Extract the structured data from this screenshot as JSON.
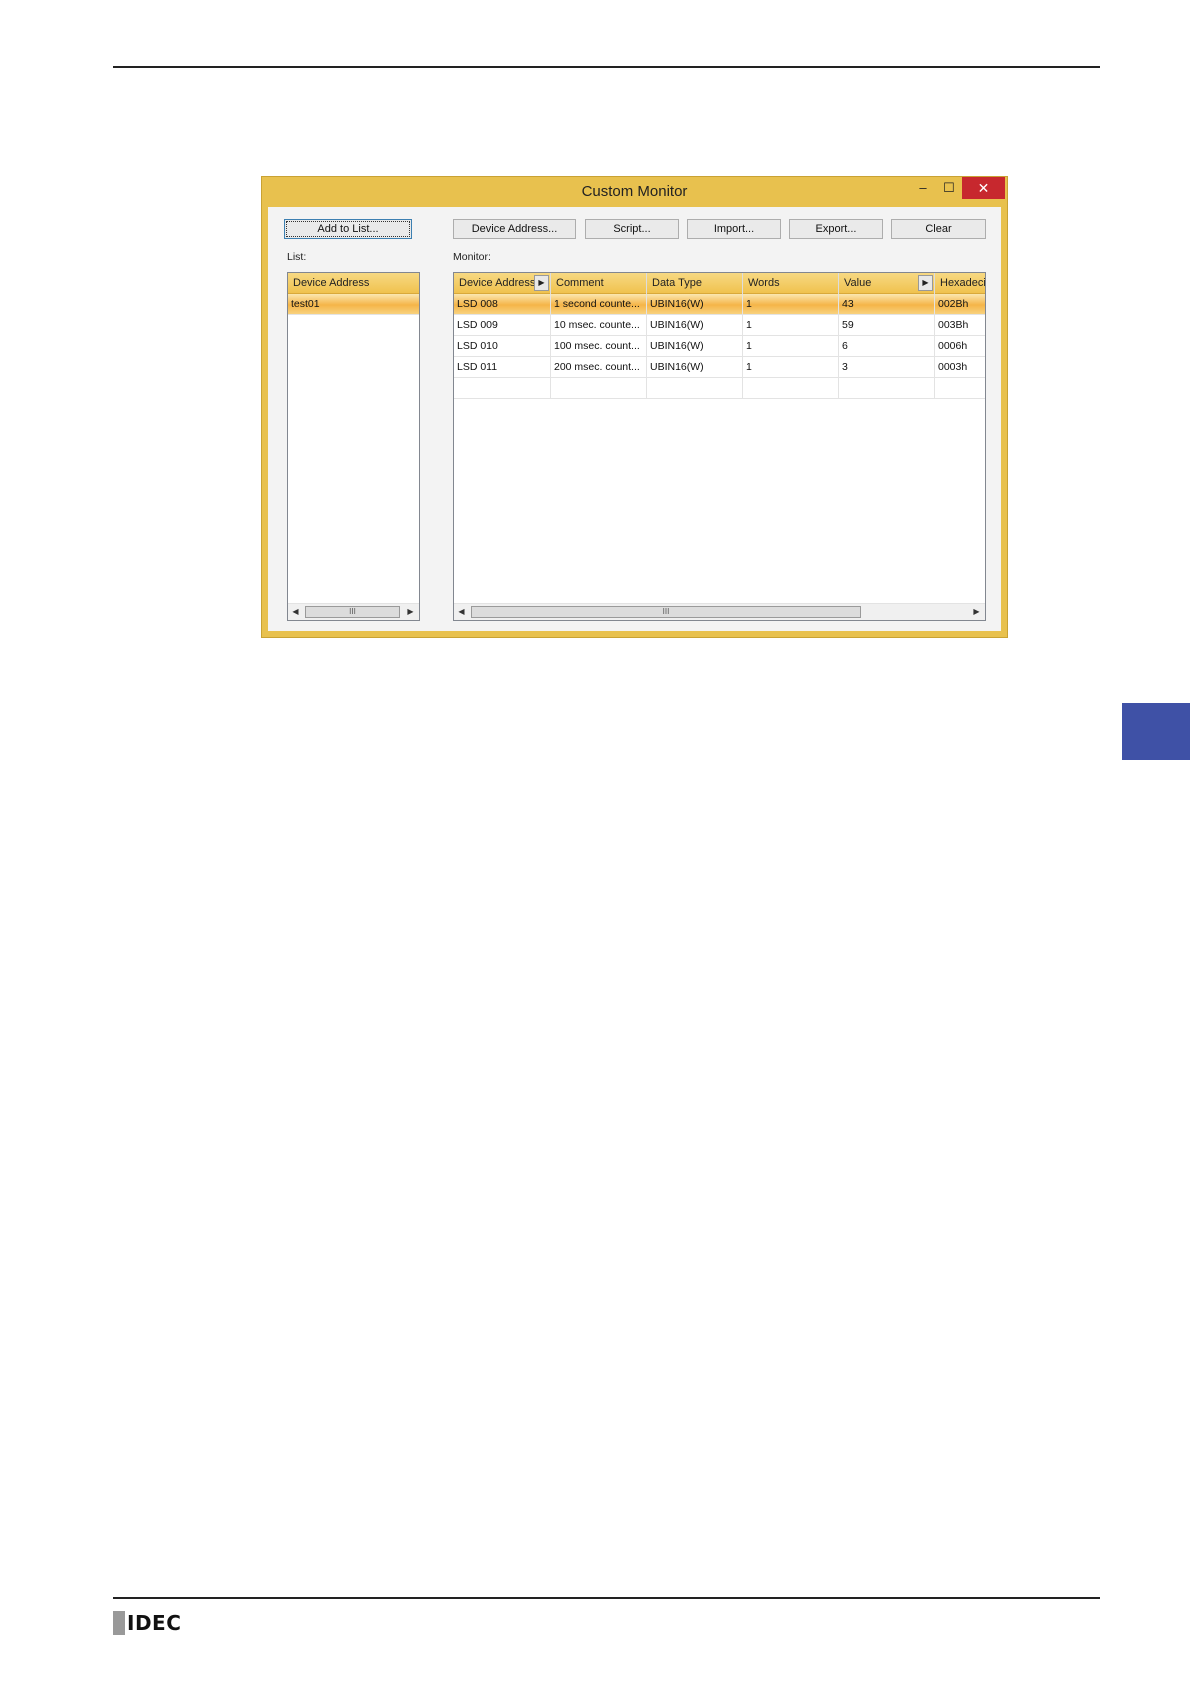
{
  "page": {
    "brand": "IDEC"
  },
  "window": {
    "title": "Custom Monitor",
    "controls": {
      "minimize": "–",
      "maximize": "☐",
      "close": "✕"
    }
  },
  "toolbar": {
    "add_to_list": "Add to List...",
    "device_address": "Device Address...",
    "script": "Script...",
    "import": "Import...",
    "export": "Export...",
    "clear": "Clear"
  },
  "list": {
    "label": "List:",
    "header": "Device Address",
    "items": [
      "test01"
    ],
    "selected_index": 0
  },
  "monitor": {
    "label": "Monitor:",
    "columns": [
      "Device Address",
      "Comment",
      "Data Type",
      "Words",
      "Value",
      "Hexadecim"
    ],
    "rows": [
      [
        "LSD 008",
        "1 second counte...",
        "UBIN16(W)",
        "1",
        "43",
        "002Bh"
      ],
      [
        "LSD 009",
        "10 msec. counte...",
        "UBIN16(W)",
        "1",
        "59",
        "003Bh"
      ],
      [
        "LSD 010",
        "100 msec. count...",
        "UBIN16(W)",
        "1",
        "6",
        "0006h"
      ],
      [
        "LSD 011",
        "200 msec. count...",
        "UBIN16(W)",
        "1",
        "3",
        "0003h"
      ]
    ],
    "selected_row": 0
  },
  "scrollbar": {
    "left_arrow": "◀",
    "right_arrow": "▶",
    "grip": "III"
  },
  "colors": {
    "window_frame": "#e8c14e",
    "close_button": "#c7282e",
    "selection": "#f5b548",
    "side_tab": "#3f51a6"
  }
}
